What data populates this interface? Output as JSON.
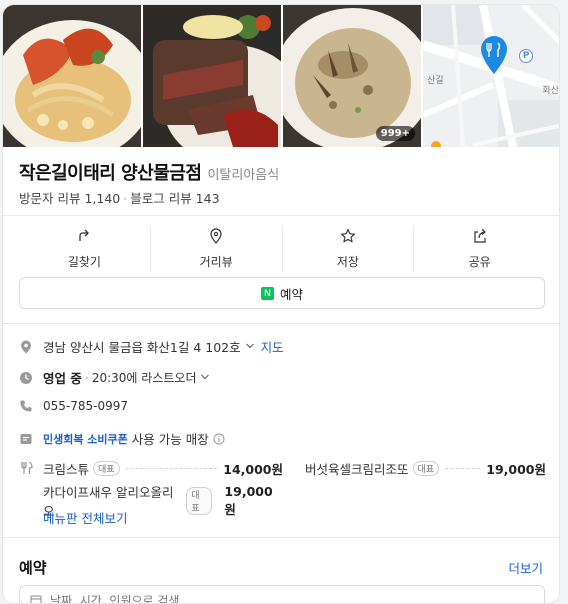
{
  "photos": {
    "count_badge": "999+"
  },
  "map": {
    "road_label_1": "산길",
    "road_label_2": "화산",
    "parking_label": "P"
  },
  "place": {
    "name": "작은길이태리 양산물금점",
    "category": "이탈리아음식",
    "visitor_reviews": "방문자 리뷰 1,140",
    "blog_reviews": "블로그 리뷰 143"
  },
  "actions": [
    {
      "label": "길찾기",
      "icon": "directions-icon"
    },
    {
      "label": "거리뷰",
      "icon": "street-view-icon"
    },
    {
      "label": "저장",
      "icon": "star-icon"
    },
    {
      "label": "공유",
      "icon": "share-icon"
    }
  ],
  "reserve_button": {
    "label": "예약",
    "badge": "N"
  },
  "info": {
    "address": "경남 양산시 물금읍 화산1길 4 102호",
    "map_link": "지도",
    "hours_status": "영업 중",
    "hours_detail": "20:30에 라스트오더",
    "phone": "055-785-0997",
    "coupon_name": "민생회복 소비쿠폰",
    "coupon_text": "사용 가능 매장"
  },
  "menu": {
    "items": [
      {
        "name": "크림스튜",
        "tag": "대표",
        "price": "14,000원"
      },
      {
        "name": "버섯육셀크림리조또",
        "tag": "대표",
        "price": "19,000원"
      },
      {
        "name": "카다이프새우 알리오올리오",
        "tag": "대표",
        "price": "19,000원"
      }
    ],
    "view_all": "메뉴판 전체보기"
  },
  "reservation": {
    "title": "예약",
    "more": "더보기",
    "field_text": "날짜, 시간, 인원으로 검색"
  },
  "colors": {
    "link": "#1a5fd6",
    "naver_green": "#03c75a",
    "map_pin": "#1e88e5"
  }
}
